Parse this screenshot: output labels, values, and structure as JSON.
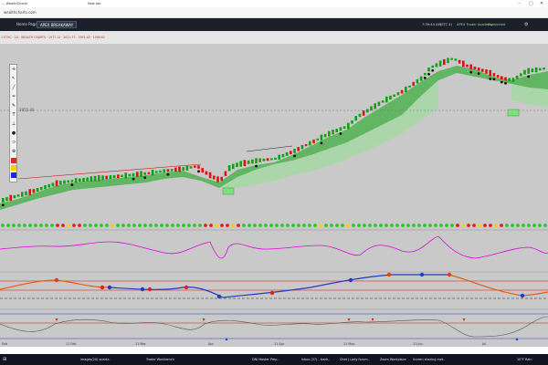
{
  "browser": {
    "tabs": [
      "— WealthCharts",
      "New tab"
    ],
    "url": "wealthcharts.com"
  },
  "app": {
    "left_tab": "Home Page",
    "active_tab": "APEX BREAKAWAY",
    "time": "7:39:44 AM",
    "ticker": "(ETC 4)",
    "status_badge": "APEX Trader Academy",
    "status_text": "Connected"
  },
  "toolbar": {
    "info": "1 ETHC · 1D · WEALTH CHARTS · 1977.12 · 2021.37 · 1955.40 · 1998.62"
  },
  "chart": {
    "band_color": "#3fae3f",
    "up_color": "#10a010",
    "down_color": "#e01010",
    "price_level_label": "1955.40"
  },
  "x_axis": {
    "labels": [
      "Feb",
      "11 Feb",
      "11 Mar",
      "Apr",
      "11 Apr",
      "11 May",
      "11 Jun",
      "Jul"
    ]
  },
  "taskbar": {
    "items": [
      "images(20) quartz..",
      "Trader Workbench",
      "DNI Master Prep..",
      "Inbox (37) - tradr..",
      "Chat | Lady forum..",
      "Zoom Workplace",
      "Screen sharing met.."
    ],
    "clock": "10°F  Rain"
  }
}
